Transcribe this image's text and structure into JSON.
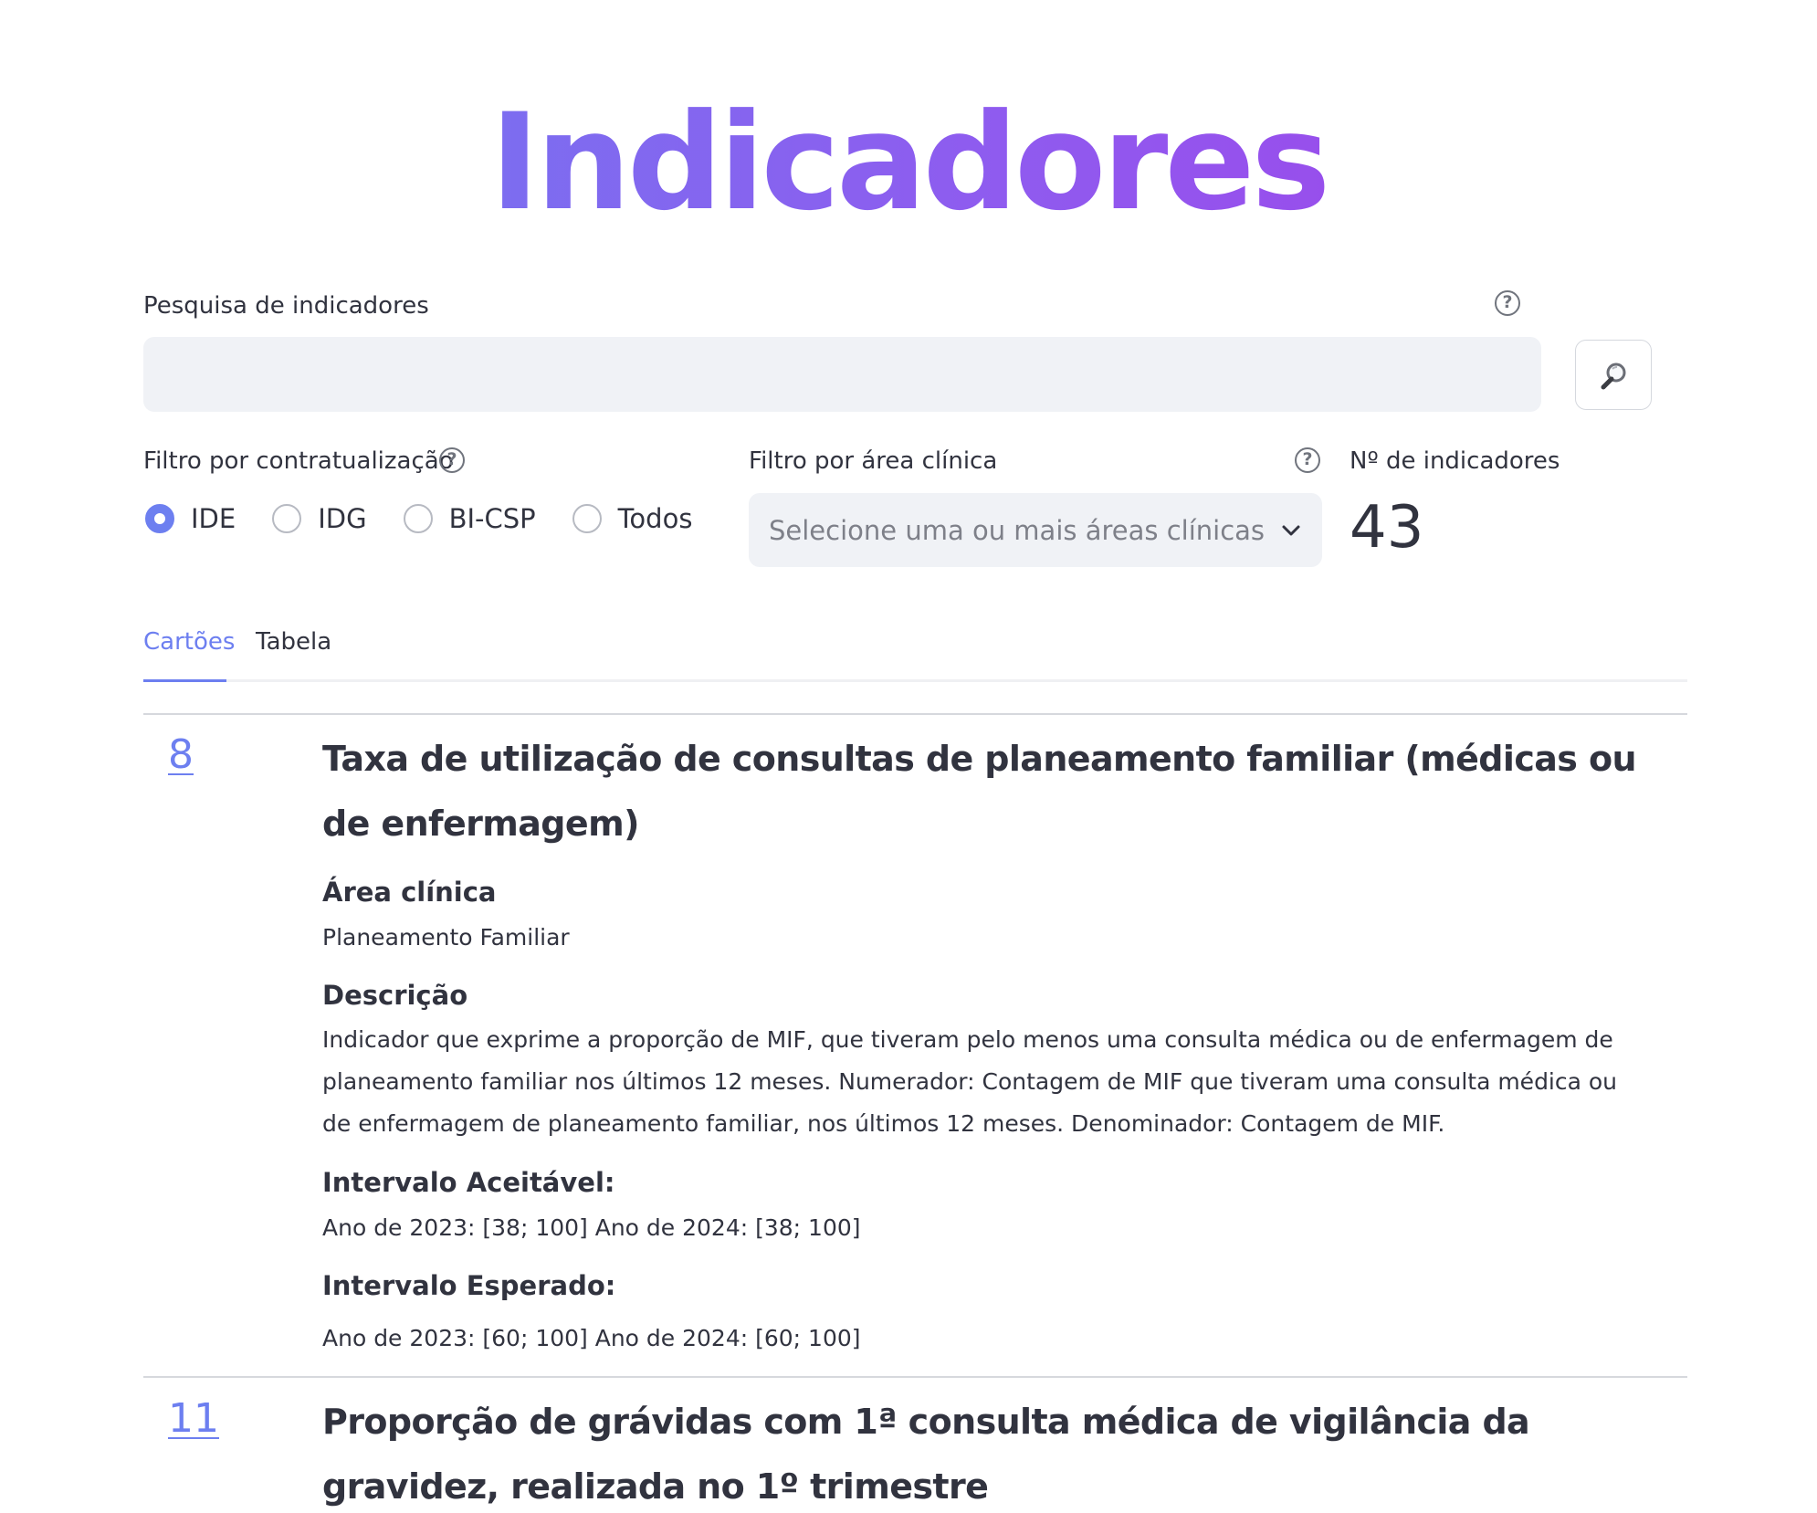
{
  "page": {
    "title": "Indicadores"
  },
  "search": {
    "label": "Pesquisa de indicadores",
    "value": "",
    "placeholder": ""
  },
  "filters": {
    "contract_label": "Filtro por contratualização",
    "contract_options": [
      "IDE",
      "IDG",
      "BI-CSP",
      "Todos"
    ],
    "contract_selected": "IDE",
    "area_label": "Filtro por área clínica",
    "area_placeholder": "Selecione uma ou mais áreas clínicas"
  },
  "count": {
    "label": "Nº de indicadores",
    "value": "43"
  },
  "tabs": [
    {
      "label": "Cartões",
      "active": true
    },
    {
      "label": "Tabela",
      "active": false
    }
  ],
  "cards": [
    {
      "id": "8",
      "title": "Taxa de utilização de consultas de planeamento familiar (médicas ou de enfermagem)",
      "area_heading": "Área clínica",
      "area": "Planeamento Familiar",
      "description_heading": "Descrição",
      "description": "Indicador que exprime a proporção de MIF, que tiveram pelo menos uma consulta médica ou de enfermagem de planeamento familiar nos últimos 12 meses. Numerador: Contagem de MIF que tiveram uma consulta médica ou de enfermagem de planeamento familiar, nos últimos 12 meses. Denominador: Contagem de MIF.",
      "acceptable_heading": "Intervalo Aceitável:",
      "acceptable": "Ano de 2023: [38; 100] Ano de 2024: [38; 100]",
      "expected_heading": "Intervalo Esperado:",
      "expected": "Ano de 2023: [60; 100] Ano de 2024: [60; 100]"
    },
    {
      "id": "11",
      "title": "Proporção de grávidas com 1ª consulta médica de vigilância da gravidez, realizada no 1º trimestre"
    }
  ],
  "icons": {
    "help": "question-circle-icon",
    "search": "magnifier-icon",
    "dropdown": "chevron-down-icon"
  },
  "colors": {
    "accent": "#6d7ff0",
    "title_gradient_start": "#6a7ff0",
    "title_gradient_end": "#a43de8",
    "input_bg": "#f0f2f6",
    "text": "#31333f"
  }
}
